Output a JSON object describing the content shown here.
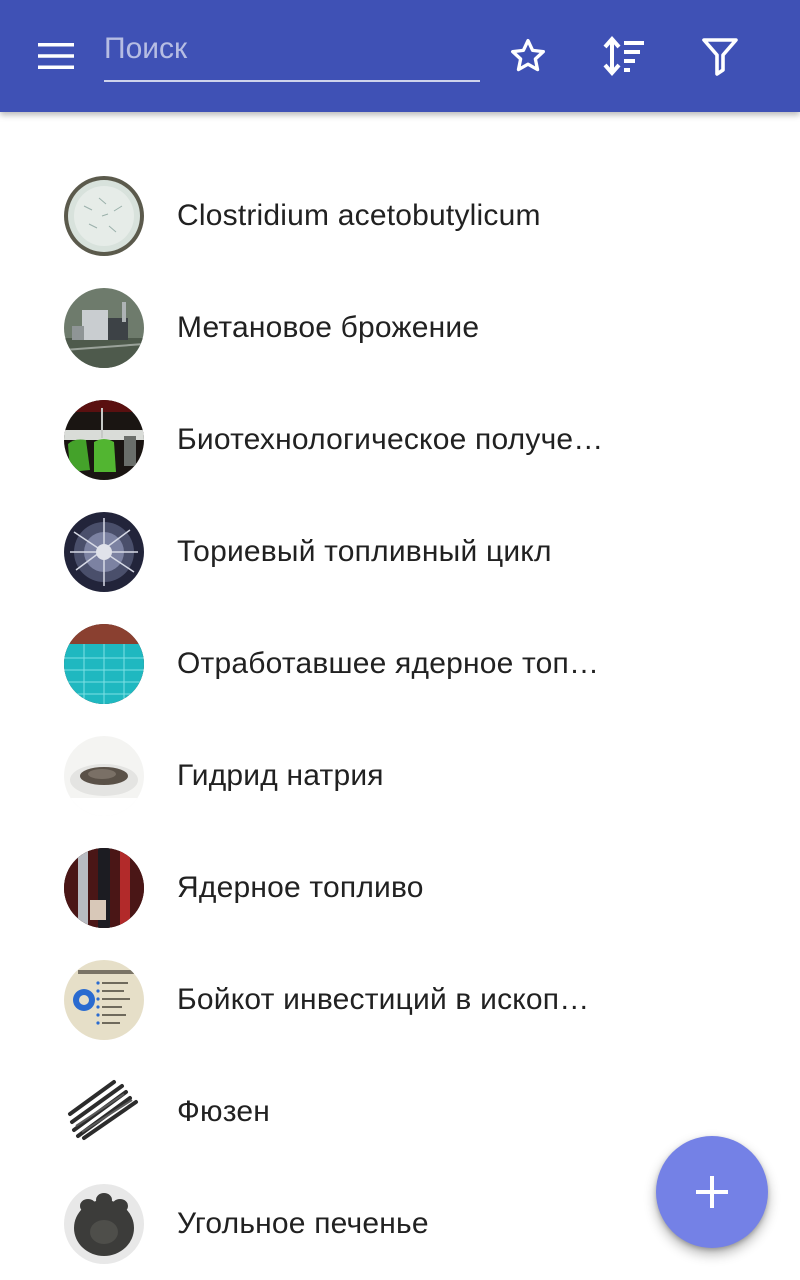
{
  "header": {
    "search_placeholder": "Поиск",
    "search_value": "",
    "icons": {
      "menu": "menu-icon",
      "favorites": "star-outline-icon",
      "sort": "sort-icon",
      "filter": "filter-icon"
    },
    "color": "#3f51b5"
  },
  "items": [
    {
      "title": "Clostridium acetobutylicum",
      "thumb": "microscope-slide"
    },
    {
      "title": "Метановое брожение",
      "thumb": "industrial-plant"
    },
    {
      "title": "Биотехнологическое получе…",
      "thumb": "lab-vessels"
    },
    {
      "title": "Ториевый топливный цикл",
      "thumb": "reactor-interior"
    },
    {
      "title": "Отработавшее ядерное топ…",
      "thumb": "spent-fuel-pool"
    },
    {
      "title": "Гидрид натрия",
      "thumb": "powder-dish"
    },
    {
      "title": "Ядерное топливо",
      "thumb": "fuel-rods"
    },
    {
      "title": "Бойкот инвестиций в ископ…",
      "thumb": "donut-chart-document"
    },
    {
      "title": "Фюзен",
      "thumb": "charcoal-sticks"
    },
    {
      "title": "Угольное печенье",
      "thumb": "charcoal-cookie"
    }
  ],
  "fab": {
    "icon": "add-icon",
    "color": "#7481e6"
  }
}
